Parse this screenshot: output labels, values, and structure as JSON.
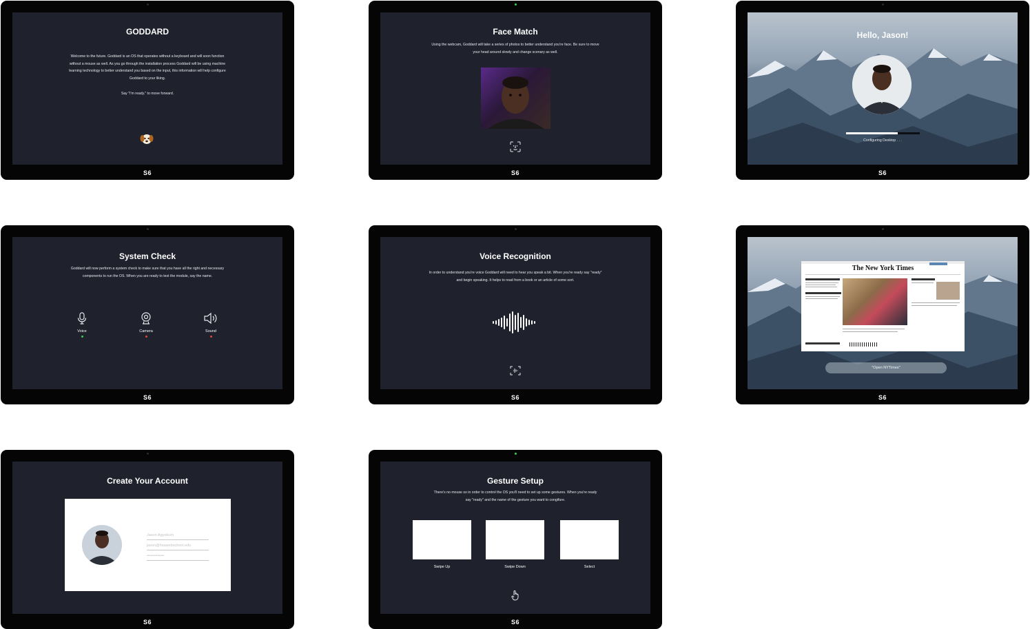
{
  "brand": "S6",
  "screens": {
    "welcome": {
      "title": "GODDARD",
      "body": "Welcome to the future. Goddard is an OS that operates without a keyboard and will soon function without a mouse as well. As you go through the installation process Goddard will be using machine learning technology to better understand you based on the input, this information will help configure Goddard to your liking.",
      "prompt": "Say \"I'm ready.\" to move forward."
    },
    "face_match": {
      "title": "Face Match",
      "body": "Using the webcam, Goddard will take a series of photos to better understand you're face. Be sure to move your head around slowly and change scenary as well."
    },
    "hello": {
      "title": "Hello, Jason!",
      "status": "Configuring Desktop . . .",
      "progress": 0.7
    },
    "system_check": {
      "title": "System Check",
      "body": "Goddard will now perform a system check to make sure that you have all the right and necessary components to run the OS. When you are ready to test the module, say the name.",
      "items": [
        {
          "label": "Voice",
          "icon": "microphone-icon",
          "status_color": "#3ecf4a"
        },
        {
          "label": "Camera",
          "icon": "webcam-icon",
          "status_color": "#e0463c"
        },
        {
          "label": "Sound",
          "icon": "speaker-icon",
          "status_color": "#e0463c"
        }
      ]
    },
    "voice_recognition": {
      "title": "Voice Recognition",
      "body": "In order to understand you're voice Goddard will need to hear you speak a bit. When you're ready say \"ready\" and begin speaking. It helps to read from a book or an article of some sort."
    },
    "browser": {
      "site_title": "The New York Times",
      "command": "\"Open NYTimes\""
    },
    "create_account": {
      "title": "Create Your Account",
      "name_placeholder": "Jason Agyekum",
      "email_placeholder": "jason@hsawebschool.edu",
      "password_placeholder": "•••••••••••••"
    },
    "gesture_setup": {
      "title": "Gesture Setup",
      "body": "There's no mouse so in order to control the OS you'll need to set up some gestures. When you're ready say \"ready\" and the name of the gesture you want to congifure.",
      "gestures": [
        "Swipe Up",
        "Swipe Down",
        "Select"
      ]
    }
  }
}
